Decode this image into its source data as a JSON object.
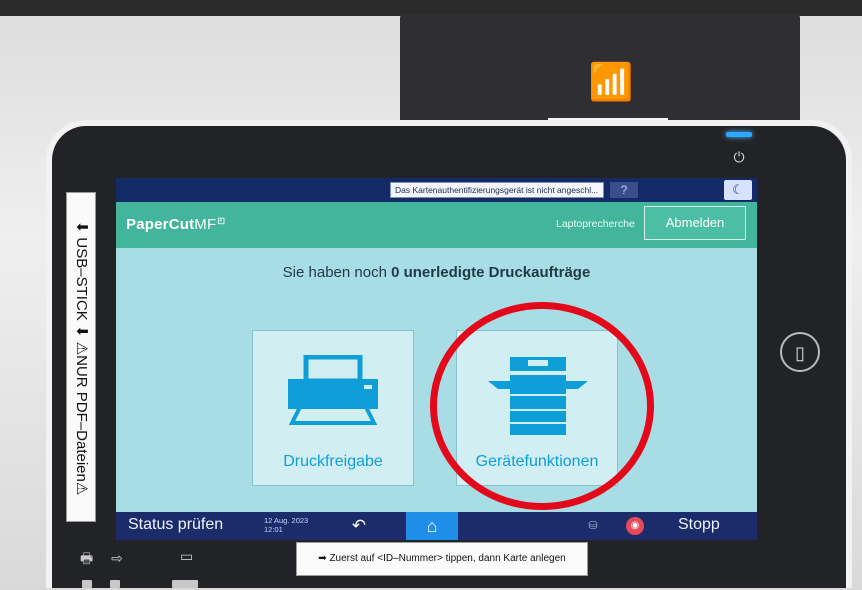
{
  "colors": {
    "screen_bg": "#a8dde6",
    "appbar": "#43b59b",
    "sysbar": "#142a66",
    "footer": "#1c2c6a",
    "home_active": "#1e8ee8",
    "tile_icon": "#0f9fd8",
    "annotation_ring": "#e3091b"
  },
  "device": {
    "usb_label": "⬇ USB–STICK ⬇ ⚠NUR PDF–Dateien⚠",
    "hint_label": "➡ Zuerst auf <ID–Nummer> tippen, dann Karte anlegen"
  },
  "system_bar": {
    "notice": "Das Kartenauthentifizierungsgerät ist nicht angeschl...",
    "help_icon": "?",
    "moon_icon": "☾"
  },
  "app_bar": {
    "logo_main": "PaperCut",
    "logo_suffix": "MF",
    "user_name": "Laptoprecherche",
    "logout_label": "Abmelden"
  },
  "main": {
    "pending_prefix": "Sie haben noch ",
    "pending_count": "0",
    "pending_suffix": " unerledigte Druckaufträge",
    "tiles": [
      {
        "label": "Druckfreigabe",
        "icon": "printer-icon"
      },
      {
        "label": "Gerätefunktionen",
        "icon": "copier-icon"
      }
    ]
  },
  "footer": {
    "status_label": "Status prüfen",
    "date": "12 Aug. 2023",
    "time": "12:01",
    "back_icon": "↶",
    "home_icon": "⌂",
    "data_icon": "⛁",
    "stop_icon": "◉",
    "stop_label": "Stopp"
  }
}
